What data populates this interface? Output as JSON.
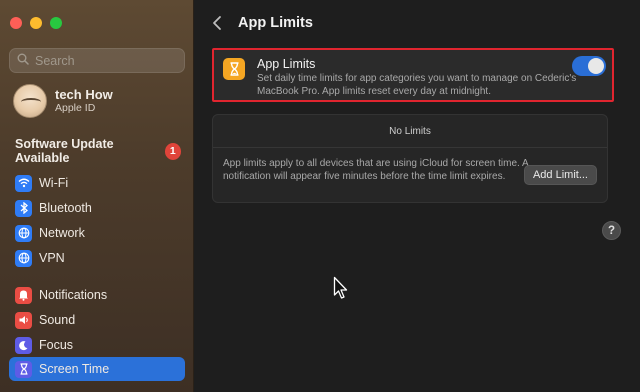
{
  "sidebar": {
    "search_placeholder": "Search",
    "profile": {
      "name": "tech How",
      "subtitle": "Apple ID"
    },
    "update": {
      "label": "Software Update Available",
      "badge": "1"
    },
    "items": [
      {
        "label": "Wi-Fi",
        "icon": "wifi-icon",
        "color": "#2f7cf6"
      },
      {
        "label": "Bluetooth",
        "icon": "bluetooth-icon",
        "color": "#2f7cf6"
      },
      {
        "label": "Network",
        "icon": "globe-icon",
        "color": "#2f7cf6"
      },
      {
        "label": "VPN",
        "icon": "vpn-globe-icon",
        "color": "#2f7cf6"
      },
      {
        "label": "Notifications",
        "icon": "bell-icon",
        "color": "#ea4d44"
      },
      {
        "label": "Sound",
        "icon": "speaker-icon",
        "color": "#ea4d44"
      },
      {
        "label": "Focus",
        "icon": "moon-icon",
        "color": "#5e5ce6"
      },
      {
        "label": "Screen Time",
        "icon": "hourglass-icon",
        "color": "#5e5ce6"
      }
    ],
    "active_item": "Screen Time"
  },
  "header": {
    "title": "App Limits"
  },
  "app_limits_card": {
    "title": "App Limits",
    "description": "Set daily time limits for app categories you want to manage on Cederic's MacBook Pro. App limits reset every day at midnight.",
    "toggle_on": true,
    "accent": "#2a6ed6",
    "highlight_border": "#e1252f"
  },
  "limits_card": {
    "empty_label": "No Limits",
    "description": "App limits apply to all devices that are using iCloud for screen time. A notification will appear five minutes before the time limit expires.",
    "add_button": "Add Limit..."
  },
  "help_label": "?"
}
